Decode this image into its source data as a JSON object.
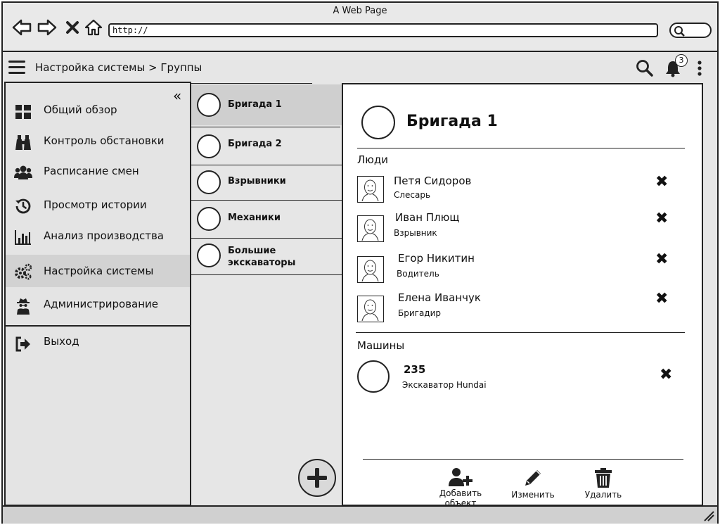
{
  "window": {
    "title": "A Web Page",
    "url": "http://"
  },
  "header": {
    "breadcrumb": "Настройка системы > Группы",
    "notification_count": "3"
  },
  "sidebar": {
    "items": [
      {
        "label": "Общий обзор",
        "icon": "dashboard-icon"
      },
      {
        "label": "Контроль обстановки",
        "icon": "binoculars-icon"
      },
      {
        "label": "Расписание смен",
        "icon": "users-icon"
      },
      {
        "label": "Просмотр истории",
        "icon": "history-icon"
      },
      {
        "label": "Анализ производства",
        "icon": "bar-chart-icon"
      },
      {
        "label": "Настройка системы",
        "icon": "gears-icon",
        "active": true
      },
      {
        "label": "Администрирование",
        "icon": "user-secret-icon"
      }
    ],
    "logout": {
      "label": "Выход",
      "icon": "sign-out-icon"
    }
  },
  "groups": [
    {
      "label": "Бригада 1",
      "active": true
    },
    {
      "label": "Бригада 2"
    },
    {
      "label": "Взрывники"
    },
    {
      "label": "Механики"
    },
    {
      "label_line1": "Большие",
      "label_line2": "экскаваторы"
    }
  ],
  "detail": {
    "title": "Бригада 1",
    "people_label": "Люди",
    "people": [
      {
        "name": "Петя Сидоров",
        "role": "Слесарь"
      },
      {
        "name": "Иван Плющ",
        "role": "Взрывник"
      },
      {
        "name": "Егор Никитин",
        "role": "Водитель"
      },
      {
        "name": "Елена Иванчук",
        "role": "Бригадир"
      }
    ],
    "machines_label": "Машины",
    "machines": [
      {
        "name": "235",
        "type": "Экскаватор Hundai"
      }
    ],
    "remove_glyph": "✖",
    "actions": {
      "add": "Добавить объект",
      "edit": "Изменить",
      "delete": "Удалить"
    }
  }
}
